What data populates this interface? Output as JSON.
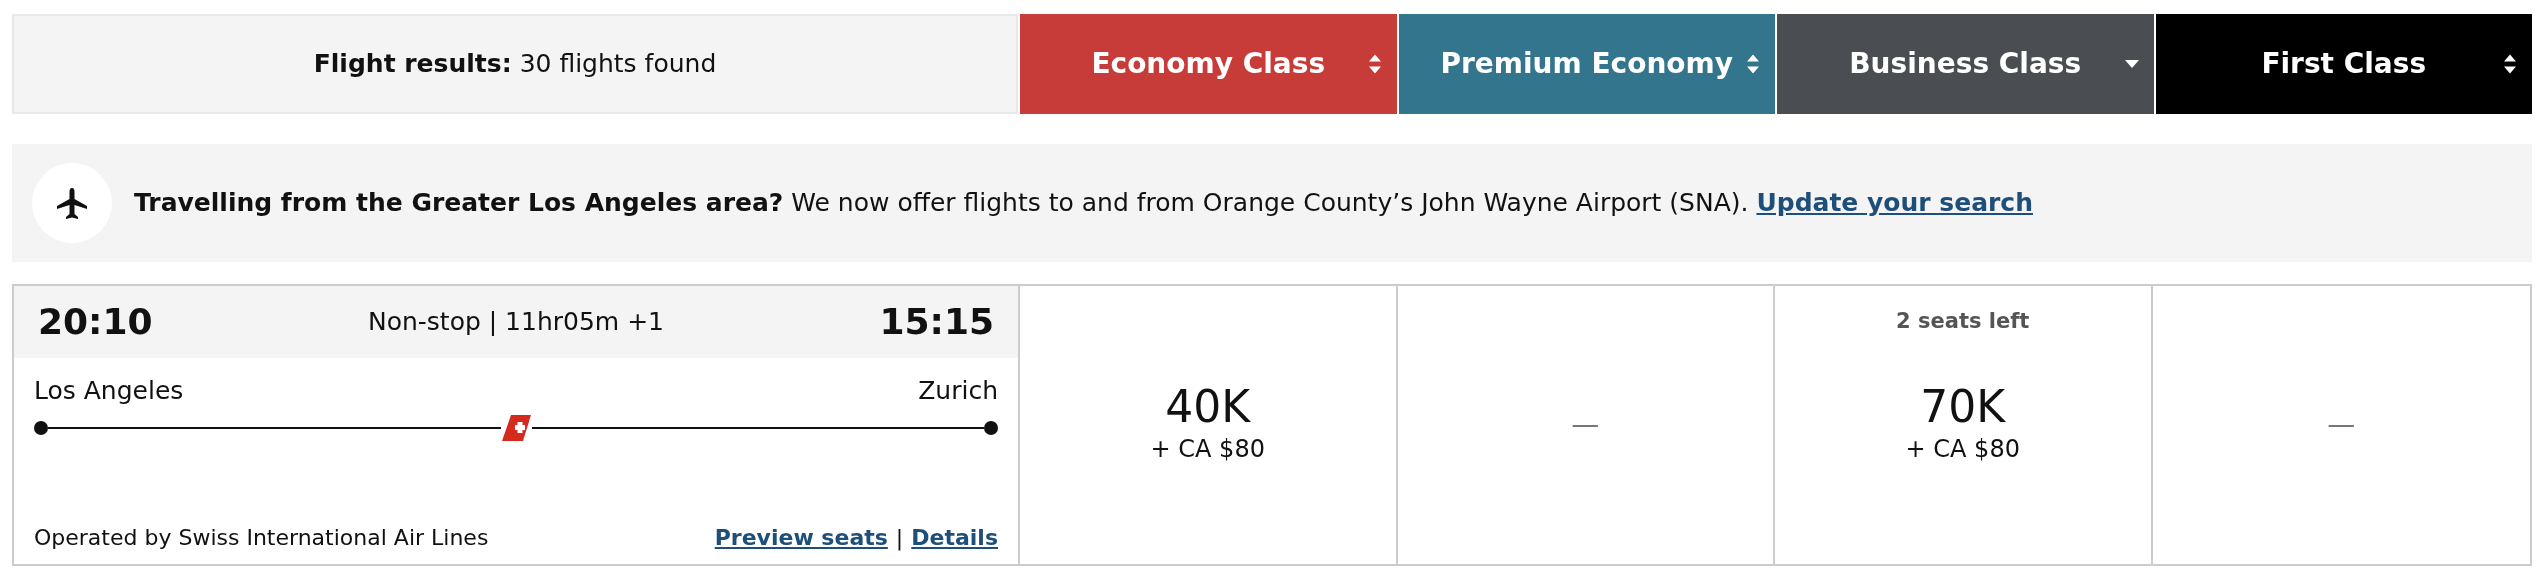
{
  "summary": {
    "label": "Flight results:",
    "value": "30 flights found"
  },
  "cabins": [
    {
      "label": "Economy Class",
      "color": "#c73c39",
      "kind": "sortable"
    },
    {
      "label": "Premium Economy",
      "color": "#33758c",
      "kind": "sortable"
    },
    {
      "label": "Business Class",
      "color": "#4a4d51",
      "kind": "sorted"
    },
    {
      "label": "First Class",
      "color": "#000000",
      "kind": "sortable"
    }
  ],
  "notice": {
    "text": "**Travelling from the Greater Los Angeles area?** We now offer flights to and from Orange County’s John Wayne Airport (SNA).",
    "link": "Update your search"
  },
  "flight": {
    "depart_time": "20:10",
    "info": "Non-stop | 11hr05m +1",
    "arrive_time": "15:15",
    "origin": "Los Angeles",
    "destination": "Zurich",
    "operator": "Operated by Swiss International Air Lines",
    "links": [
      "Preview seats",
      "Details"
    ],
    "separator": "|"
  },
  "fares": [
    {
      "kind": "price",
      "price": "40K",
      "fees": "+ CA $80"
    },
    {
      "kind": "none",
      "text": "—"
    },
    {
      "kind": "price",
      "note": "2 seats left",
      "price": "70K",
      "fees": "+ CA $80"
    },
    {
      "kind": "none",
      "text": "—"
    }
  ]
}
